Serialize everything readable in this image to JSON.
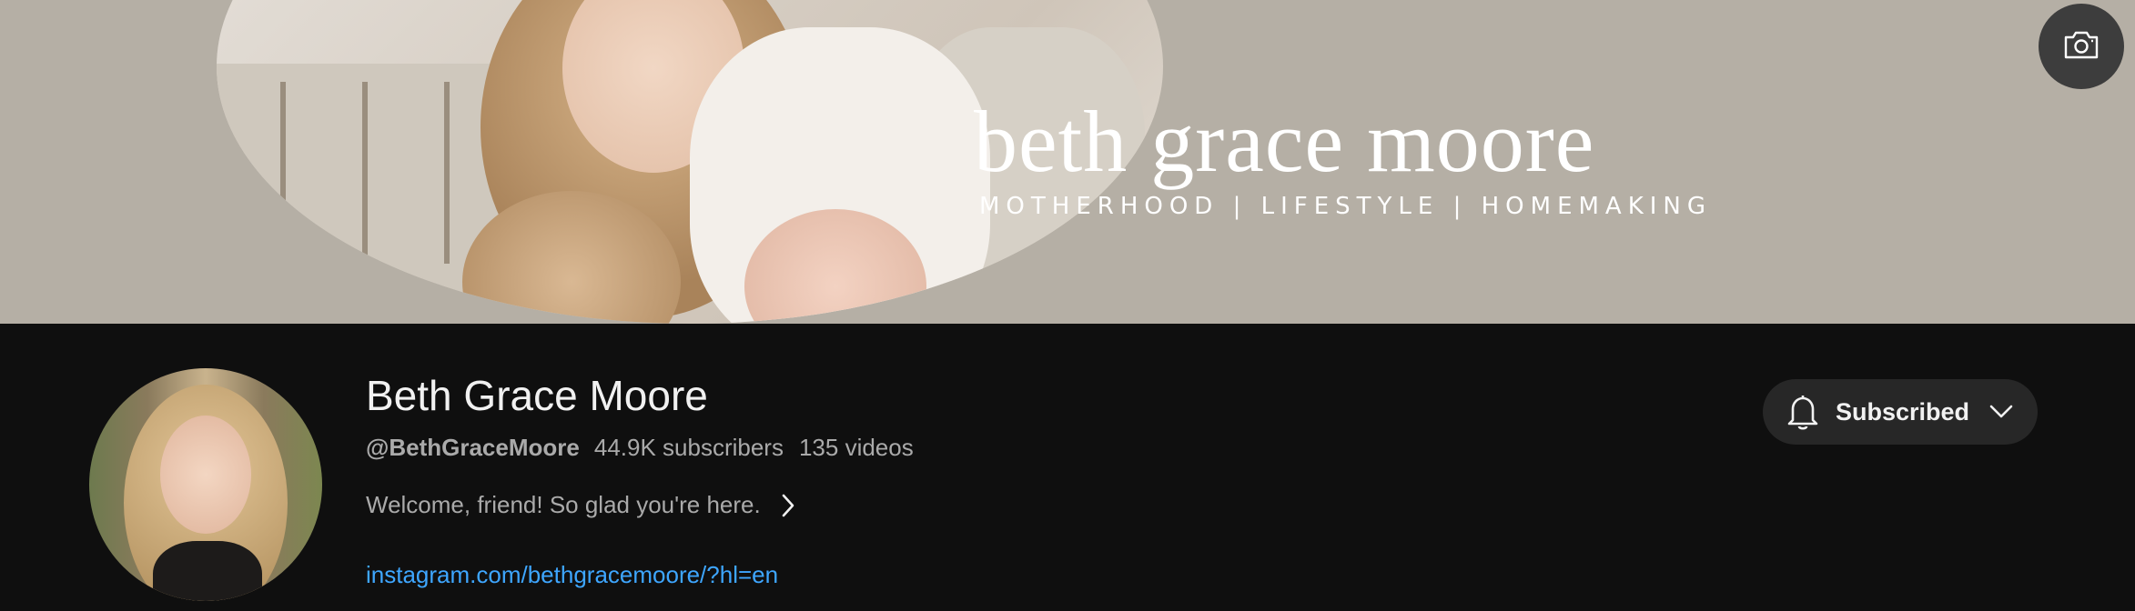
{
  "banner": {
    "title": "beth grace moore",
    "tagline": "MOTHERHOOD | LIFESTYLE | HOMEMAKING",
    "background_color": "#b5afa5",
    "edit_icon": "camera-icon"
  },
  "channel": {
    "name": "Beth Grace Moore",
    "handle": "@BethGraceMoore",
    "subscribers": "44.9K subscribers",
    "videos": "135 videos",
    "description": "Welcome, friend! So glad you're here.",
    "link": "instagram.com/bethgracemoore/?hl=en",
    "link_color": "#3ea6ff"
  },
  "subscribe": {
    "label": "Subscribed",
    "icon": "bell-icon",
    "dropdown_icon": "chevron-down-icon"
  }
}
